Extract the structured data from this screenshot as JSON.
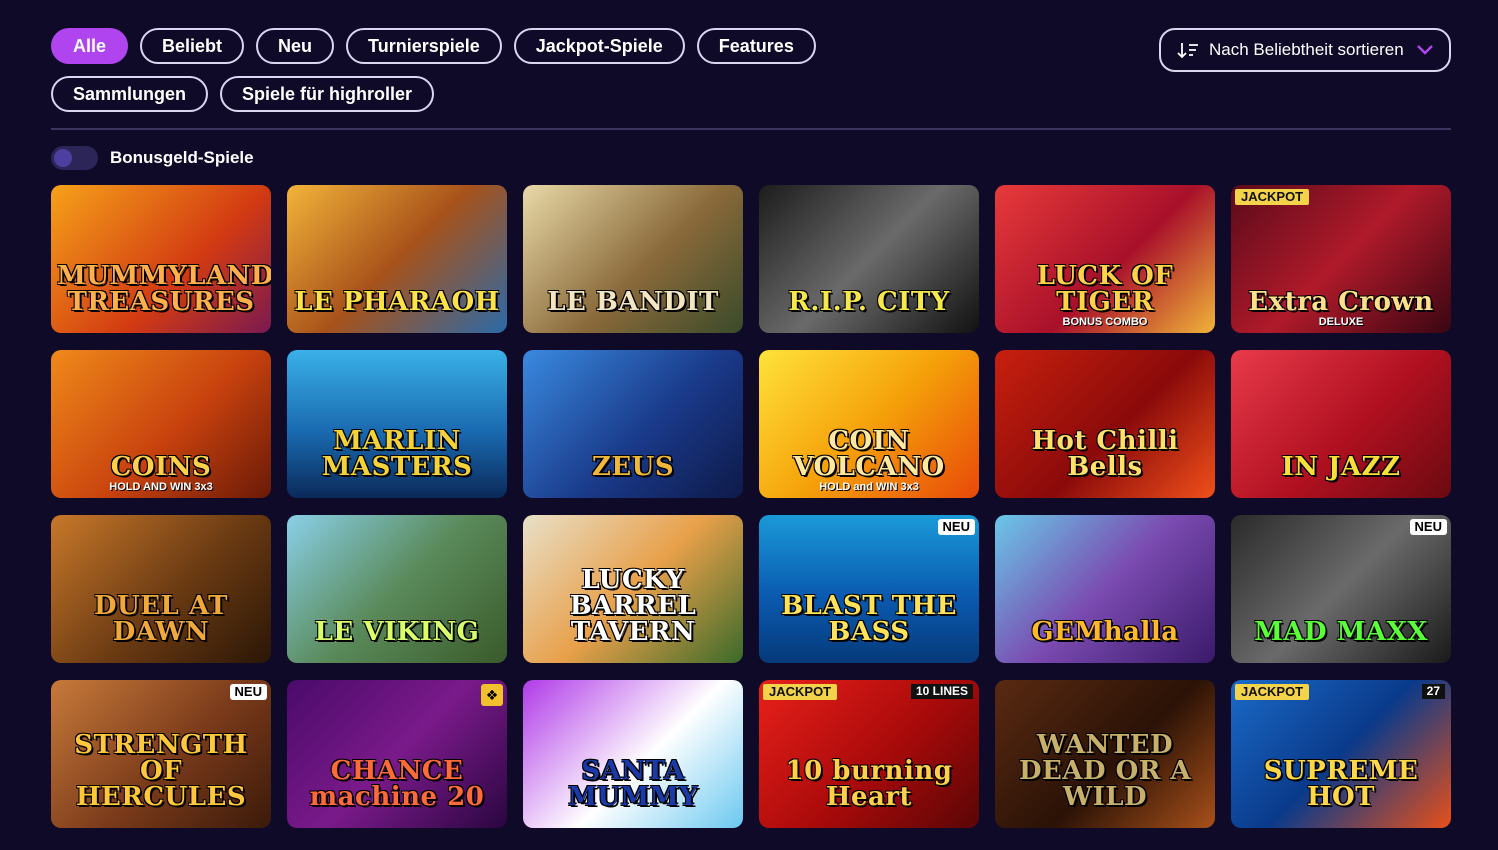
{
  "filters": [
    {
      "label": "Alle",
      "active": true
    },
    {
      "label": "Beliebt",
      "active": false
    },
    {
      "label": "Neu",
      "active": false
    },
    {
      "label": "Turnierspiele",
      "active": false
    },
    {
      "label": "Jackpot-Spiele",
      "active": false
    },
    {
      "label": "Features",
      "active": false
    },
    {
      "label": "Sammlungen",
      "active": false
    },
    {
      "label": "Spiele für highroller",
      "active": false
    }
  ],
  "sort": {
    "label": "Nach Beliebtheit sortieren",
    "icon": "sort-icon",
    "chevron": "chevron-down-icon"
  },
  "bonus_toggle": {
    "label": "Bonusgeld-Spiele",
    "enabled": false
  },
  "games": [
    {
      "title": "MUMMYLAND TREASURES",
      "sub": "",
      "bg": "linear-gradient(135deg,#f6a21a,#d23a12 60%,#7a1a50)",
      "color": "#ffb04a",
      "badge": "",
      "jackpot": "",
      "lines": "",
      "gift": false
    },
    {
      "title": "LE PHARAOH",
      "sub": "",
      "bg": "linear-gradient(135deg,#f3b43a,#a8521a 50%,#2b6aa8)",
      "color": "#ffe14a",
      "badge": "",
      "jackpot": "",
      "lines": "",
      "gift": false
    },
    {
      "title": "LE BANDIT",
      "sub": "",
      "bg": "linear-gradient(135deg,#e9d9a8,#8a6a3a 55%,#3a4a2a)",
      "color": "#f4e6c0",
      "badge": "",
      "jackpot": "",
      "lines": "",
      "gift": false
    },
    {
      "title": "R.I.P. CITY",
      "sub": "",
      "bg": "linear-gradient(135deg,#1c1c1c,#6a6a6a 50%,#111)",
      "color": "#f5e84a",
      "badge": "",
      "jackpot": "",
      "lines": "",
      "gift": false
    },
    {
      "title": "LUCK OF TIGER",
      "sub": "BONUS COMBO",
      "bg": "linear-gradient(135deg,#e83a3a,#a8102a 55%,#f0b43a)",
      "color": "#ffd24a",
      "badge": "",
      "jackpot": "",
      "lines": "",
      "gift": false
    },
    {
      "title": "Extra Crown",
      "sub": "DELUXE",
      "bg": "linear-gradient(135deg,#5a0a1a,#b01a2a 50%,#3a0612)",
      "color": "#ffe08a",
      "badge": "",
      "jackpot": "JACKPOT",
      "lines": "",
      "gift": false
    },
    {
      "title": "COINS",
      "sub": "HOLD AND WIN 3x3",
      "bg": "linear-gradient(135deg,#f08a1a,#c8420e 55%,#6a1a08)",
      "color": "#ffd04a",
      "badge": "",
      "jackpot": "",
      "lines": "",
      "gift": false
    },
    {
      "title": "MARLIN MASTERS",
      "sub": "",
      "bg": "linear-gradient(180deg,#3ab0e8,#1a6ab0 55%,#0a2a5a)",
      "color": "#f4d23a",
      "badge": "",
      "jackpot": "",
      "lines": "",
      "gift": false
    },
    {
      "title": "ZEUS",
      "sub": "",
      "bg": "linear-gradient(135deg,#3a8ae0,#1a3a8a 55%,#0e1a4a)",
      "color": "#f0b83a",
      "badge": "",
      "jackpot": "",
      "lines": "",
      "gift": false
    },
    {
      "title": "COIN VOLCANO",
      "sub": "HOLD and WIN 3x3",
      "bg": "linear-gradient(135deg,#ffe23a,#f5a20a 50%,#e8480a)",
      "color": "#ffe8a0",
      "badge": "",
      "jackpot": "",
      "lines": "",
      "gift": false
    },
    {
      "title": "Hot Chilli Bells",
      "sub": "",
      "bg": "linear-gradient(135deg,#c8200e,#8a0a0a 55%,#f0501a)",
      "color": "#ffe06a",
      "badge": "",
      "jackpot": "",
      "lines": "",
      "gift": false
    },
    {
      "title": "IN JAZZ",
      "sub": "",
      "bg": "linear-gradient(135deg,#e83a4a,#b01020 55%,#6a0a10)",
      "color": "#f8e03a",
      "badge": "",
      "jackpot": "",
      "lines": "",
      "gift": false
    },
    {
      "title": "DUEL AT DAWN",
      "sub": "",
      "bg": "linear-gradient(135deg,#c8782a,#6a3a12 55%,#2a1606)",
      "color": "#f0a83a",
      "badge": "",
      "jackpot": "",
      "lines": "",
      "gift": false
    },
    {
      "title": "LE VIKING",
      "sub": "",
      "bg": "linear-gradient(135deg,#8ad0e8,#5a8a5a 50%,#3a5a2a)",
      "color": "#d8ff6a",
      "badge": "",
      "jackpot": "",
      "lines": "",
      "gift": false
    },
    {
      "title": "LUCKY BARREL TAVERN",
      "sub": "",
      "bg": "linear-gradient(135deg,#e8e0c8,#e8a04a 50%,#3a6a2a)",
      "color": "#ffffff",
      "badge": "",
      "jackpot": "",
      "lines": "",
      "gift": false
    },
    {
      "title": "BLAST THE BASS",
      "sub": "",
      "bg": "linear-gradient(180deg,#1a9ad8,#0a5ab0 55%,#063a7a)",
      "color": "#ffe25a",
      "badge": "NEU",
      "jackpot": "",
      "lines": "",
      "gift": false
    },
    {
      "title": "GEMhalla",
      "sub": "",
      "bg": "linear-gradient(135deg,#6ac8e8,#7a4ab0 50%,#3a1a6a)",
      "color": "#ffb82a",
      "badge": "",
      "jackpot": "",
      "lines": "",
      "gift": false
    },
    {
      "title": "MAD MAXX",
      "sub": "",
      "bg": "linear-gradient(135deg,#2a2a2a,#6a6a6a 50%,#1a1a1a)",
      "color": "#5aff3a",
      "badge": "NEU",
      "jackpot": "",
      "lines": "",
      "gift": false
    },
    {
      "title": "STRENGTH OF HERCULES",
      "sub": "",
      "bg": "linear-gradient(135deg,#c87a3a,#7a3a1a 55%,#3a1a0a)",
      "color": "#ffc83a",
      "badge": "NEU",
      "jackpot": "",
      "lines": "",
      "gift": false
    },
    {
      "title": "CHANCE machine 20",
      "sub": "",
      "bg": "linear-gradient(135deg,#4a0a6a,#7a1a8a 50%,#2a0640)",
      "color": "#ff6a3a",
      "badge": "",
      "jackpot": "",
      "lines": "",
      "gift": true
    },
    {
      "title": "SANTA MUMMY",
      "sub": "",
      "bg": "linear-gradient(135deg,#b03ae8,#ffffff 55%,#6ac8f0)",
      "color": "#1a3aa8",
      "badge": "",
      "jackpot": "",
      "lines": "",
      "gift": false
    },
    {
      "title": "10 burning Heart",
      "sub": "",
      "bg": "linear-gradient(135deg,#e8201a,#a80a0a 55%,#5a0606)",
      "color": "#ffd04a",
      "badge": "",
      "jackpot": "JACKPOT",
      "lines": "10 LINES",
      "gift": false
    },
    {
      "title": "WANTED DEAD OR A WILD",
      "sub": "",
      "bg": "linear-gradient(135deg,#5a2a12,#2a1206 55%,#a8501a)",
      "color": "#c8b06a",
      "badge": "",
      "jackpot": "",
      "lines": "",
      "gift": false
    },
    {
      "title": "SUPREME HOT",
      "sub": "",
      "bg": "linear-gradient(135deg,#1a6ac8,#0a3a8a 50%,#e8501a)",
      "color": "#ffd84a",
      "badge": "",
      "jackpot": "JACKPOT",
      "lines": "27",
      "gift": false
    }
  ]
}
